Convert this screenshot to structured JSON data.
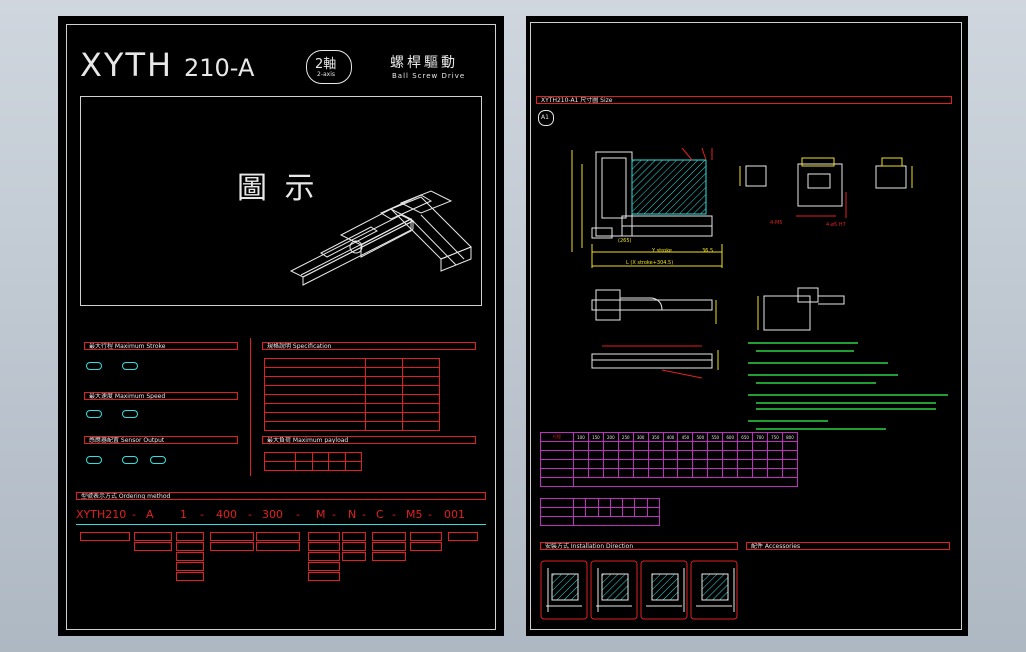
{
  "left_sheet": {
    "model": "XYTH",
    "model_sub": "210-A",
    "axis_badge": "2軸",
    "axis_badge_sub": "2-axis",
    "title_cn": "螺桿驅動",
    "title_en": "Ball Screw Drive",
    "figure_label": "圖 示",
    "sections": {
      "max_stroke": "最大行程 Maximum Stroke",
      "max_speed": "最大速度 Maximum Speed",
      "sensor": "感應器配置 Sensor Output",
      "spec": "規格說明 Specification",
      "max_payload": "最大負荷 Maximum payload",
      "ordering": "型號表示方式 Ordering method"
    },
    "order_code": [
      "XYTH210",
      "-",
      "A",
      "1",
      "-",
      "400",
      "-",
      "300",
      "-",
      "M",
      "-",
      "N",
      "-",
      "C",
      "-",
      "M5",
      "-",
      "001"
    ]
  },
  "right_sheet": {
    "header": "XYTH210-A1 尺寸圖 Size",
    "circle_label": "A1",
    "dim_stroke": "Y stroke",
    "dim_total": "L (X stroke+304.5)",
    "dim_left": "(265)",
    "dim_right": "36.5",
    "dim_hole": "4-M5",
    "dim_pin": "4-ø5 H7",
    "table_header": "行程",
    "stroke_values": [
      "100",
      "150",
      "200",
      "250",
      "300",
      "350",
      "400",
      "450",
      "500",
      "550",
      "600",
      "650",
      "700",
      "750",
      "800"
    ],
    "section_install": "安裝方式 Installation Direction",
    "section_accessories": "配件 Accessories"
  },
  "colors": {
    "background": "#000000",
    "line_red": "#e02020",
    "line_green": "#2fe04a",
    "line_cyan": "#30e0e0",
    "line_yellow": "#f0e020",
    "line_magenta": "#c030c0"
  }
}
